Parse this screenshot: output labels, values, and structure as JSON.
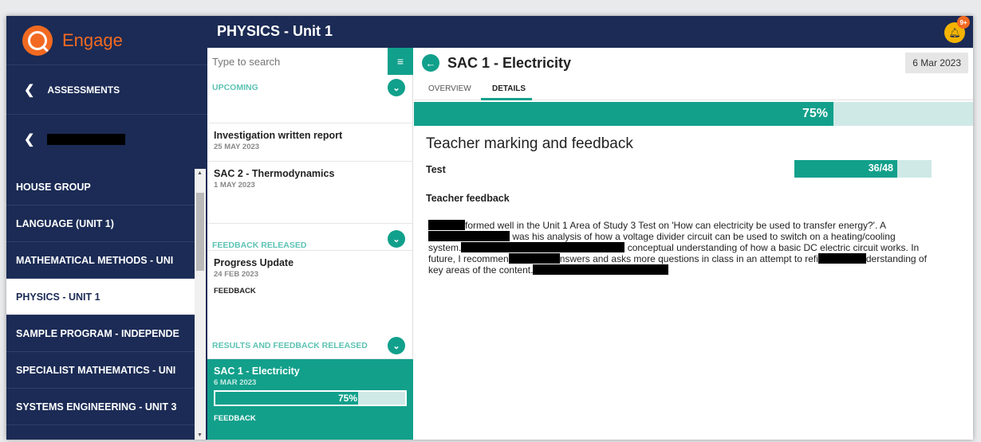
{
  "app": {
    "name": "Engage"
  },
  "sidebar": {
    "back_assessments": "ASSESSMENTS",
    "subjects": [
      "HOUSE GROUP",
      "LANGUAGE (UNIT 1)",
      "MATHEMATICAL METHODS - UNI",
      "PHYSICS - UNIT 1",
      "SAMPLE PROGRAM - INDEPENDE",
      "SPECIALIST MATHEMATICS - UNI",
      "SYSTEMS ENGINEERING - UNIT 3"
    ],
    "active_subject": "PHYSICS - UNIT 1"
  },
  "header": {
    "title": "PHYSICS - Unit 1",
    "notification_badge": "9+"
  },
  "list": {
    "search_placeholder": "Type to search",
    "upcoming": {
      "label": "UPCOMING",
      "items": [
        {
          "title": "Investigation written report",
          "date": "25 MAY 2023"
        },
        {
          "title": "SAC 2 - Thermodynamics",
          "date": "1 MAY 2023"
        }
      ]
    },
    "feedback_released": {
      "label": "FEEDBACK RELEASED",
      "item": {
        "title": "Progress Update",
        "date": "24 FEB 2023",
        "tag": "FEEDBACK"
      }
    },
    "results_released": {
      "label": "RESULTS AND FEEDBACK RELEASED",
      "item": {
        "title": "SAC 1 - Electricity",
        "date": "6 MAR 2023",
        "percent_label": "75%",
        "progress": 0.75,
        "tag": "FEEDBACK"
      }
    }
  },
  "detail": {
    "title": "SAC 1 - Electricity",
    "date": "6 Mar 2023",
    "tabs": [
      "OVERVIEW",
      "DETAILS"
    ],
    "active_tab": "DETAILS",
    "overall_label": "75%",
    "overall_progress": 0.75,
    "section_title": "Teacher marking and feedback",
    "test_label": "Test",
    "test_score": "36/48",
    "test_progress": 0.75,
    "feedback_label": "Teacher feedback",
    "feedback": {
      "p1": "formed well in the Unit 1 Area of Study 3 Test on 'How can electricity be used to transfer energy?'. A",
      "p2": "was his analysis of how a voltage divider circuit can be used to switch on a heating/cooling",
      "p3": "system.",
      "p4": "conceptual understanding of how a basic DC electric circuit works. In",
      "p5": "future, I recommen",
      "p6": "nswers and asks more questions in class in an attempt to refi",
      "p7": "derstanding of",
      "p8": "key areas of the content."
    }
  },
  "colors": {
    "navy": "#1b2b55",
    "teal": "#12a08b",
    "light_teal": "#cfe9e7",
    "orange": "#f26a21",
    "bell": "#f5b400"
  }
}
